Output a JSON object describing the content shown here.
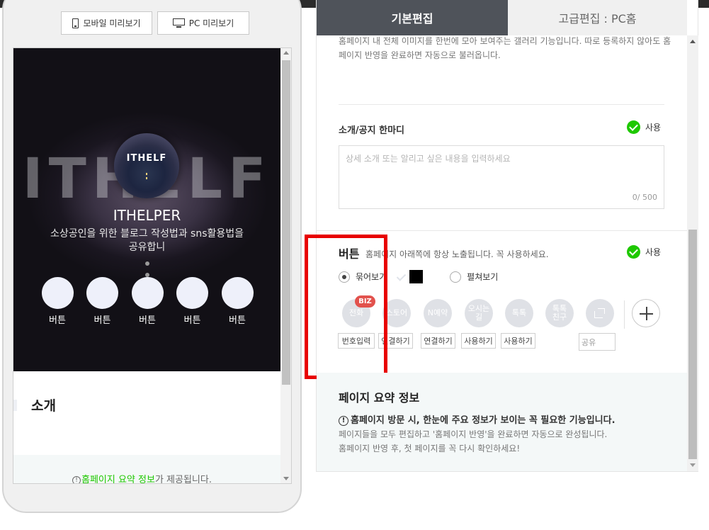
{
  "preview": {
    "mobile_button": "모바일 미리보기",
    "pc_button": "PC 미리보기",
    "hero": {
      "background_text": "ITHELF",
      "logo_text": "ITHELF",
      "name": "ITHELPER",
      "subtitle": "소상공인을 위한 블로그 작성법과 sns활용법을 공유합니",
      "buttons": [
        "버튼",
        "버튼",
        "버튼",
        "버튼",
        "버튼"
      ]
    },
    "intro_title": "소개",
    "summary_prefix": "홈페이지 요약 정보",
    "summary_suffix": "가 제공됩니다."
  },
  "editor": {
    "tabs": [
      "기본편집",
      "고급편집 : PC홈"
    ],
    "gallery_description": "홈페이지 내 전체 이미지를 한번에 모아 보여주는 갤러리 기능입니다. 따로 등록하지 않아도 홈페이지 반영을 완료하면 자동으로 불러옵니다.",
    "notice": {
      "title": "소개/공지 한마디",
      "use_label": "사용",
      "placeholder": "상세 소개 또는 알리고 싶은 내용을 입력하세요",
      "counter": "0/ 500"
    },
    "buttons_section": {
      "title": "버튼",
      "description": "홈페이지 아래쪽에 항상 노출됩니다. 꼭 사용하세요.",
      "use_label": "사용",
      "radio_grouped": "묶어보기",
      "radio_expanded": "펼쳐보기",
      "items": [
        {
          "label": "전화",
          "tag": "번호입력",
          "badge": "BIZ"
        },
        {
          "label": "스토어",
          "tag": "연결하기"
        },
        {
          "label": "N예약",
          "tag": "연결하기"
        },
        {
          "label": "오시는길",
          "tag": "사용하기"
        },
        {
          "label": "톡톡",
          "tag": "사용하기"
        },
        {
          "label": "톡톡\n친구",
          "tag": ""
        },
        {
          "label": "",
          "tag": "공유",
          "icon": "share-icon"
        }
      ]
    },
    "summary": {
      "title": "페이지 요약 정보",
      "headline": "홈페이지 방문 시, 한눈에 주요 정보가 보이는 꼭 필요한 기능입니다.",
      "desc1": "페이지들을 모두 편집하고 '홈페이지 반영'을 완료하면 자동으로 완성됩니다.",
      "desc2": "홈페이지 반영 후, 첫 페이지를 꼭 다시 확인하세요!"
    }
  },
  "colors": {
    "accent_green": "#1ec800",
    "highlight_red": "#e80000",
    "tab_active": "#4f535a",
    "biz_badge": "#e2524d"
  }
}
